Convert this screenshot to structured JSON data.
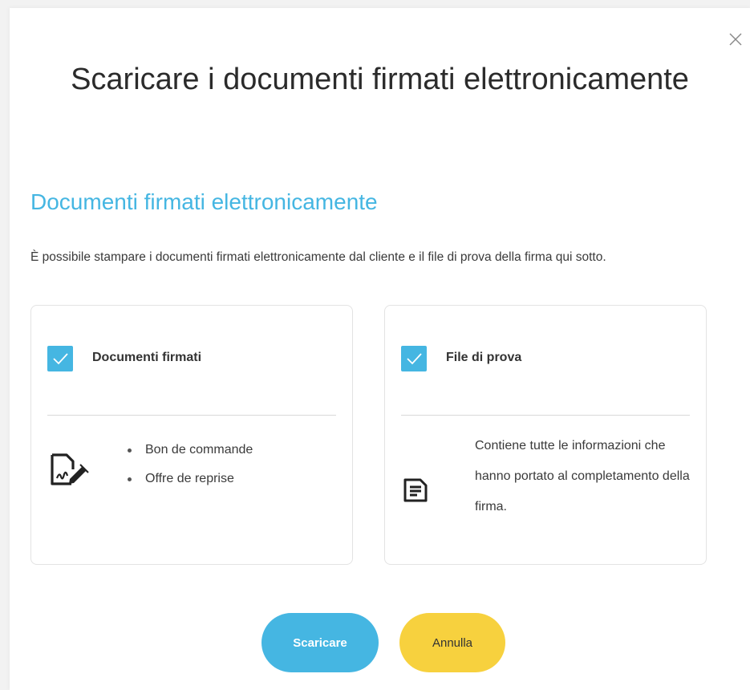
{
  "dialog": {
    "title": "Scaricare i documenti firmati elettronicamente",
    "section_title": "Documenti firmati elettronicamente",
    "description": "È possibile stampare i documenti firmati elettronicamente dal cliente e il file di prova della firma qui sotto."
  },
  "cards": {
    "signed_documents": {
      "label": "Documenti firmati",
      "checked": true,
      "items": [
        "Bon de commande",
        "Offre de reprise"
      ],
      "icon": "signed-document-icon"
    },
    "proof_file": {
      "label": "File di prova",
      "checked": true,
      "description": "Contiene tutte le informazioni che hanno portato al completamento della firma.",
      "icon": "file-text-icon"
    }
  },
  "buttons": {
    "download": "Scaricare",
    "cancel": "Annulla"
  },
  "colors": {
    "accent": "#45b6e2",
    "secondary": "#f7d13e",
    "text": "#3a3a3a"
  }
}
